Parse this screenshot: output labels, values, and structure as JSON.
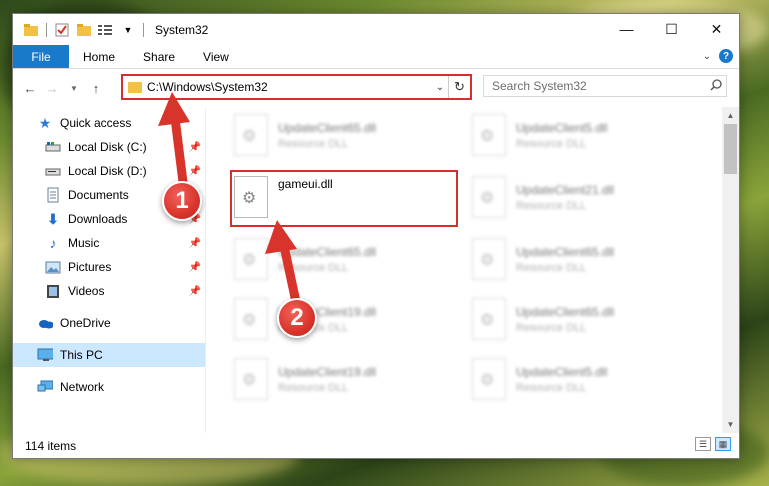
{
  "window": {
    "title": "System32",
    "controls": {
      "minimize": "—",
      "maximize": "☐",
      "close": "✕"
    }
  },
  "ribbon": {
    "file_tab": "File",
    "tabs": [
      "Home",
      "Share",
      "View"
    ]
  },
  "address": {
    "path": "C:\\Windows\\System32",
    "search_placeholder": "Search System32"
  },
  "nav": {
    "items": [
      {
        "label": "Quick access",
        "icon": "star-icon",
        "pinned": false
      },
      {
        "label": "Local Disk (C:)",
        "icon": "drive-icon",
        "pinned": true
      },
      {
        "label": "Local Disk (D:)",
        "icon": "drive-icon",
        "pinned": true
      },
      {
        "label": "Documents",
        "icon": "documents-icon",
        "pinned": true
      },
      {
        "label": "Downloads",
        "icon": "download-icon",
        "pinned": true
      },
      {
        "label": "Music",
        "icon": "music-icon",
        "pinned": true
      },
      {
        "label": "Pictures",
        "icon": "pictures-icon",
        "pinned": true
      },
      {
        "label": "Videos",
        "icon": "videos-icon",
        "pinned": true
      },
      {
        "label": "OneDrive",
        "icon": "cloud-icon",
        "pinned": false
      },
      {
        "label": "This PC",
        "icon": "computer-icon",
        "pinned": false
      },
      {
        "label": "Network",
        "icon": "network-icon",
        "pinned": false
      }
    ]
  },
  "files": {
    "highlighted": {
      "name": "gameui.dll",
      "desc": ""
    },
    "blurred": [
      {
        "name": "UpdateClient65.dll",
        "desc": "Resource DLL"
      },
      {
        "name": "UpdateClient5.dll",
        "desc": "Resource DLL"
      },
      {
        "name": "UpdateClient21.dll",
        "desc": "Resource DLL"
      },
      {
        "name": "UpdateClient65.dll",
        "desc": "Resource DLL"
      },
      {
        "name": "UpdateClient65.dll",
        "desc": "Resource DLL"
      },
      {
        "name": "UpdateClient19.dll",
        "desc": "Resource DLL"
      },
      {
        "name": "UpdateClient65.dll",
        "desc": "Resource DLL"
      },
      {
        "name": "UpdateClient19.dll",
        "desc": "Resource DLL"
      },
      {
        "name": "UpdateClient5.dll",
        "desc": "Resource DLL"
      }
    ]
  },
  "status": {
    "item_count": "114 items"
  },
  "annotations": {
    "marker1": "1",
    "marker2": "2",
    "color": "#d32f2f"
  }
}
